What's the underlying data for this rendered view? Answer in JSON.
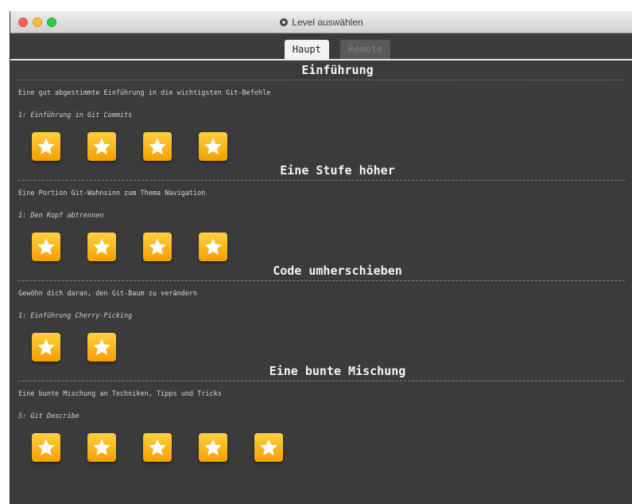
{
  "window": {
    "title": "Level auswählen"
  },
  "tabs": [
    {
      "label": "Haupt",
      "active": true
    },
    {
      "label": "Remote",
      "active": false
    }
  ],
  "sections": [
    {
      "title": "Einführung",
      "description": "Eine gut abgestimmte Einführung in die wichtigsten Git-Befehle",
      "level": "1: Einführung in Git Commits",
      "star_count": 4
    },
    {
      "title": "Eine Stufe höher",
      "description": "Eine Portion Git-Wahnsinn zum Thema Navigation",
      "level": "1: Den Kopf abtrennen",
      "star_count": 4
    },
    {
      "title": "Code umherschieben",
      "description": "Gewöhn dich daran, den Git-Baum zu verändern",
      "level": "1: Einführung Cherry-Picking",
      "star_count": 2
    },
    {
      "title": "Eine bunte Mischung",
      "description": "Eine bunte Mischung an Techniken, Tipps und Tricks",
      "level": "5: Git Describe",
      "star_count": 5
    }
  ],
  "icons": {
    "level_button": "star-icon",
    "title": "settings-icon"
  },
  "colors": {
    "background": "#3b3b3b",
    "star_button": "#ffc107",
    "star": "#ffffff",
    "active_tab": "#f2f2f2",
    "inactive_tab": "#5a5a5a"
  }
}
